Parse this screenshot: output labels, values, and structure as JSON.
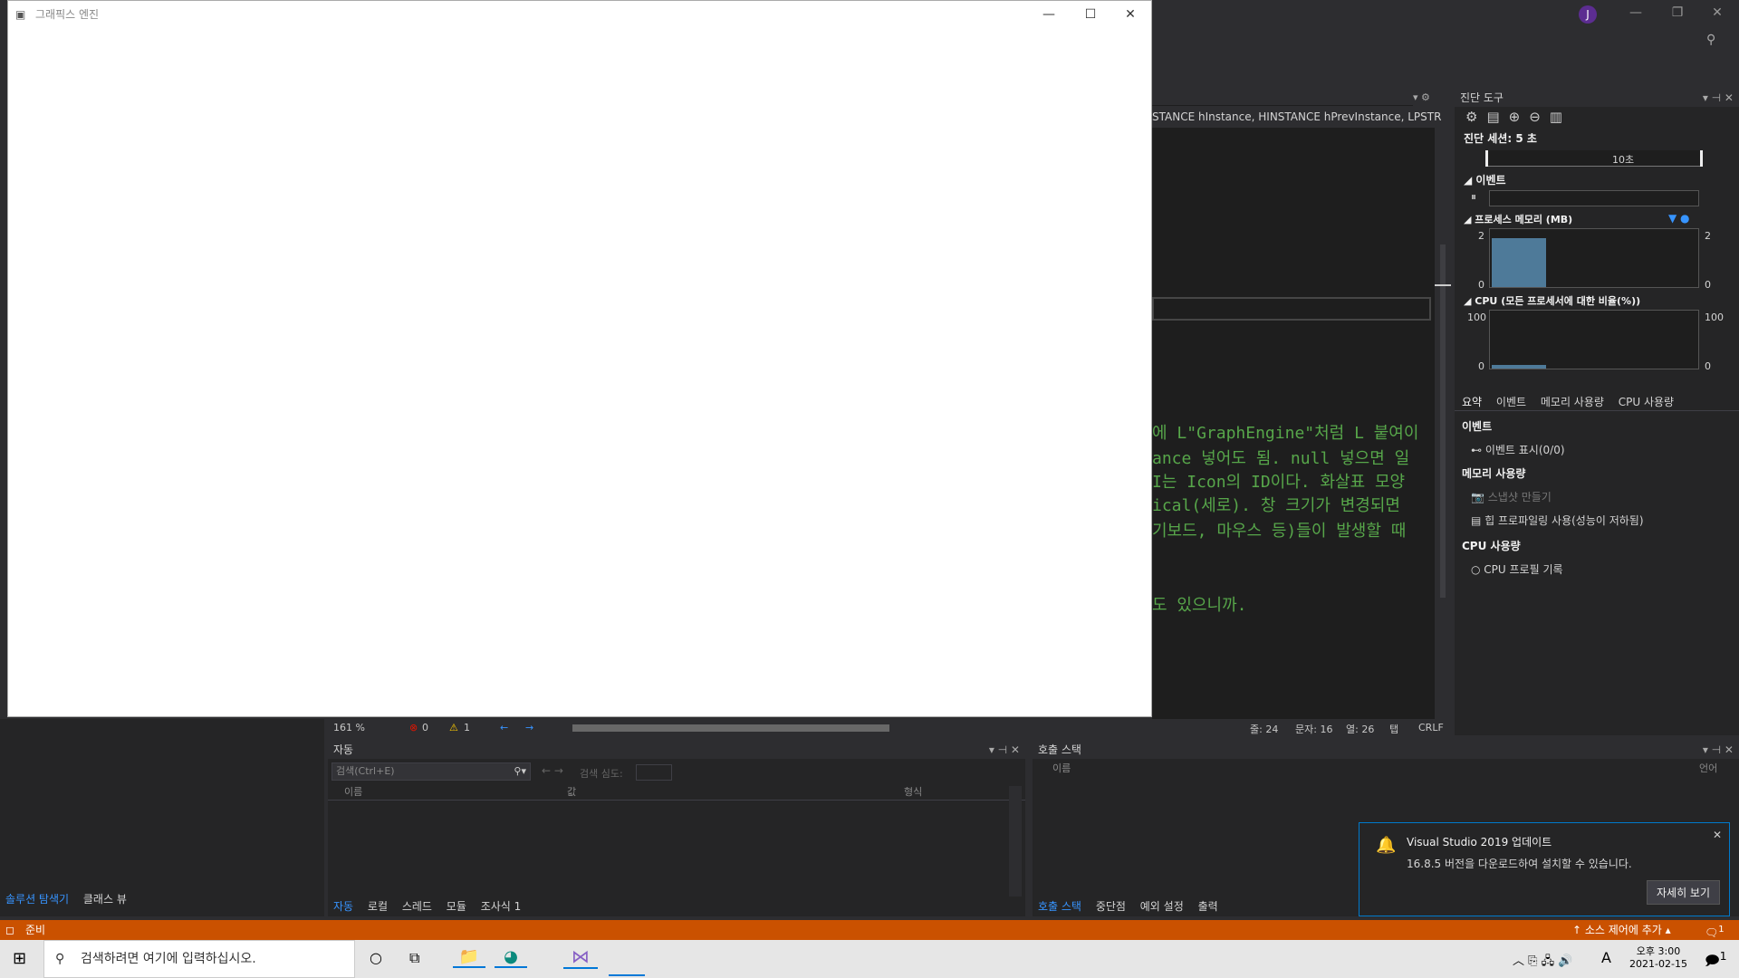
{
  "graphics_window": {
    "title": "그래픽스 엔진",
    "minimize": "—",
    "maximize": "☐",
    "close": "✕"
  },
  "vs": {
    "avatar": "J",
    "minimize": "—",
    "restore": "❐",
    "close": "✕"
  },
  "editor": {
    "tab_text": "STANCE hInstance, HINSTANCE hPrevInstance, LPSTR",
    "lines": [
      "에 L\"GraphEngine\"처럼 L 붙여이",
      "ance 넣어도 됨. null 넣으면 일",
      "I는 Icon의 ID이다. 화살표 모양",
      "ical(세로). 창 크기가 변경되면",
      "기보드, 마우스 등)들이 발생할 때",
      "도 있으니까."
    ],
    "status": {
      "zoom": "161 %",
      "errors": "0",
      "warnings": "1",
      "line": "줄: 24",
      "char": "문자: 16",
      "col": "열: 26",
      "tab": "탭",
      "eol": "CRLF"
    }
  },
  "diagnostics": {
    "title": "진단 도구",
    "session": "진단 세션: 5 초",
    "timeline_label": "10초",
    "events_header": "이벤트",
    "memory_header": "프로세스 메모리 (MB)",
    "memory_axis": {
      "top": "2",
      "bottom": "0",
      "right_top": "2",
      "right_bottom": "0"
    },
    "cpu_header": "CPU (모든 프로세서에 대한 비율(%))",
    "cpu_axis": {
      "top": "100",
      "bottom": "0",
      "right_top": "100",
      "right_bottom": "0"
    },
    "tabs": [
      "요약",
      "이벤트",
      "메모리 사용량",
      "CPU 사용량"
    ],
    "summary": {
      "events_title": "이벤트",
      "show_events": "이벤트 표시(0/0)",
      "memory_title": "메모리 사용량",
      "snapshot": "스냅샷 만들기",
      "heap_profiling": "힙 프로파일링 사용(성능이 저하됨)",
      "cpu_title": "CPU 사용량",
      "cpu_profile": "CPU 프로필 기록"
    },
    "memory_fill": 0.85,
    "cpu_fill": 0.06
  },
  "autos": {
    "title": "자동",
    "search_placeholder": "검색(Ctrl+E)",
    "search_depth": "검색 심도:",
    "col_name": "이름",
    "col_value": "값",
    "col_type": "형식",
    "tabs": [
      "자동",
      "로컬",
      "스레드",
      "모듈",
      "조사식 1"
    ]
  },
  "callstack": {
    "title": "호출 스택",
    "col_name": "이름",
    "col_lang": "언어",
    "tabs": [
      "호출 스택",
      "중단점",
      "예외 설정",
      "출력"
    ]
  },
  "solution": {
    "tabs": [
      "솔루션 탐색기",
      "클래스 뷰"
    ]
  },
  "toast": {
    "title": "Visual Studio 2019 업데이트",
    "body": "16.8.5 버전을 다운로드하여 설치할 수 있습니다.",
    "button": "자세히 보기",
    "close": "✕"
  },
  "statusbar": {
    "ready": "준비",
    "source_control": "소스 제어에 추가",
    "notifications": "1"
  },
  "taskbar": {
    "search_placeholder": "검색하려면 여기에 입력하십시오.",
    "time": "오후 3:00",
    "date": "2021-02-15",
    "ime": "A",
    "notif_count": "1"
  }
}
